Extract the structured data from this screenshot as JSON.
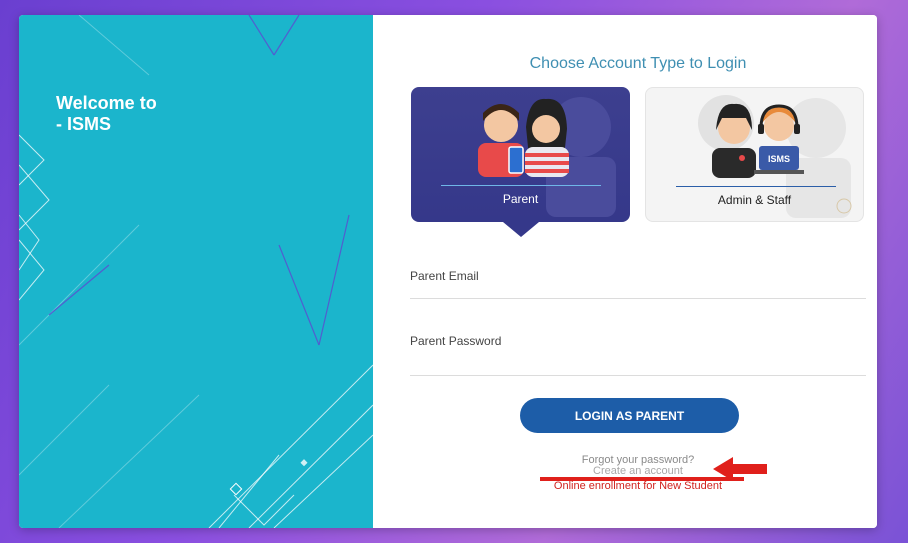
{
  "welcome": {
    "line1": "Welcome to",
    "line2": "- ISMS"
  },
  "login_panel": {
    "title": "Choose Account Type to Login",
    "account_types": [
      {
        "label": "Parent",
        "selected": true
      },
      {
        "label": "Admin & Staff",
        "selected": false,
        "badge": "ISMS"
      }
    ],
    "email_placeholder": "Parent Email",
    "password_placeholder": "Parent Password",
    "login_button": "LOGIN AS PARENT",
    "forgot_password": "Forgot your password?",
    "create_account": "Create an account",
    "online_enrollment": "Online enrollment for New Student"
  },
  "colors": {
    "left_panel": "#1bb5cc",
    "parent_card": "#35388a",
    "button": "#1d5da8",
    "title": "#3f8fb2",
    "annotation": "#e0201b"
  }
}
